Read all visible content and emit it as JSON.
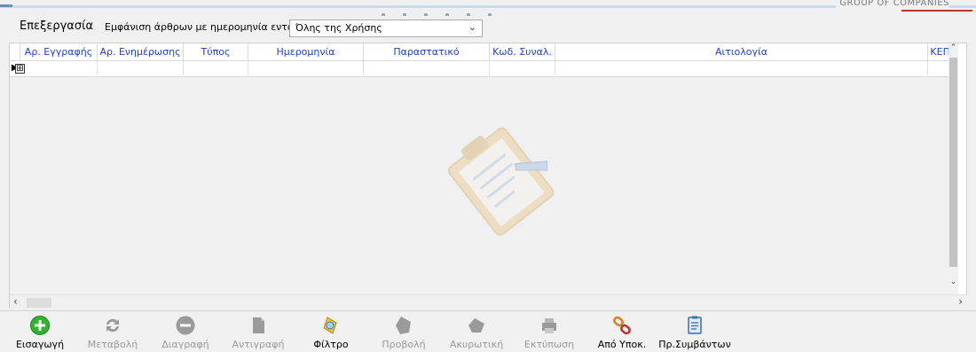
{
  "brand": "GROUP OF COMPANIES",
  "toolbar": {
    "menu_edit": "Επεξεργασία",
    "filter_label": "Εμφάνιση άρθρων με ημερομηνία εντός",
    "period_select": "Όλης της Χρήσης"
  },
  "grid": {
    "columns": [
      "Αρ. Εγγραφής",
      "Αρ. Ενημέρωσης",
      "Τύπος",
      "Ημερομηνία",
      "Παραστατικό",
      "Κωδ. Συναλ.",
      "Αιτιολογία",
      "ΚΕΠΥ"
    ],
    "row_expand": "⊞"
  },
  "buttons": [
    {
      "label": "Εισαγωγή",
      "icon": "plus-circle-icon",
      "enabled": true
    },
    {
      "label": "Μεταβολή",
      "icon": "refresh-icon",
      "enabled": false
    },
    {
      "label": "Διαγραφή",
      "icon": "minus-circle-icon",
      "enabled": false
    },
    {
      "label": "Αντιγραφή",
      "icon": "copy-icon",
      "enabled": false
    },
    {
      "label": "Φίλτρο",
      "icon": "filter-icon",
      "enabled": true
    },
    {
      "label": "Προβολή",
      "icon": "view-icon",
      "enabled": false
    },
    {
      "label": "Ακυρωτική",
      "icon": "cancel-icon",
      "enabled": false
    },
    {
      "label": "Εκτύπωση",
      "icon": "print-icon",
      "enabled": false
    },
    {
      "label": "Από Υποκ.",
      "icon": "link-icon",
      "enabled": true
    },
    {
      "label": "Πρ.Συμβάντων",
      "icon": "notes-icon",
      "enabled": true
    }
  ],
  "colors": {
    "header_text": "#1f3fd6",
    "accent_green": "#2fb52f"
  }
}
